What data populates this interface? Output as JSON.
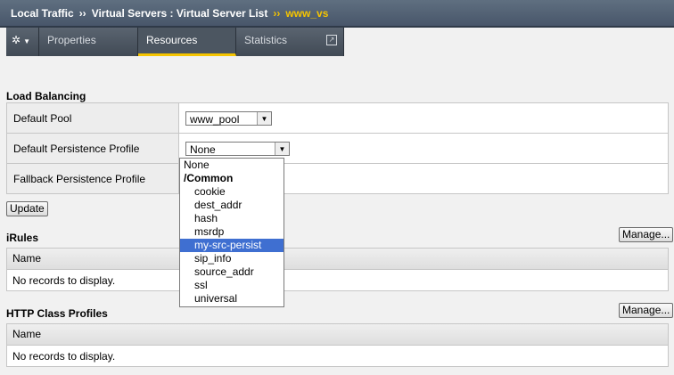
{
  "breadcrumb": {
    "part1": "Local Traffic",
    "part2": "Virtual Servers : Virtual Server List",
    "current": "www_vs",
    "separator": "››"
  },
  "tabs": {
    "properties": "Properties",
    "resources": "Resources",
    "statistics": "Statistics",
    "gear_icon": "gear-icon",
    "popout_icon": "external-link-icon"
  },
  "load_balancing": {
    "title": "Load Balancing",
    "default_pool_label": "Default Pool",
    "default_pool_value": "www_pool",
    "default_persistence_label": "Default Persistence Profile",
    "default_persistence_value": "None",
    "fallback_persistence_label": "Fallback Persistence Profile",
    "update_label": "Update"
  },
  "persistence_dropdown": {
    "options": [
      "None",
      "/Common",
      "cookie",
      "dest_addr",
      "hash",
      "msrdp",
      "my-src-persist",
      "sip_info",
      "source_addr",
      "ssl",
      "universal"
    ],
    "highlighted": "my-src-persist",
    "highlight_color": "#3f6fd1"
  },
  "irules": {
    "title": "iRules",
    "manage_label": "Manage...",
    "column_name": "Name",
    "empty": "No records to display."
  },
  "http_class": {
    "title": "HTTP Class Profiles",
    "manage_label": "Manage...",
    "column_name": "Name",
    "empty": "No records to display."
  },
  "colors": {
    "accent": "#f5c400",
    "titlebar": "#55647a"
  }
}
